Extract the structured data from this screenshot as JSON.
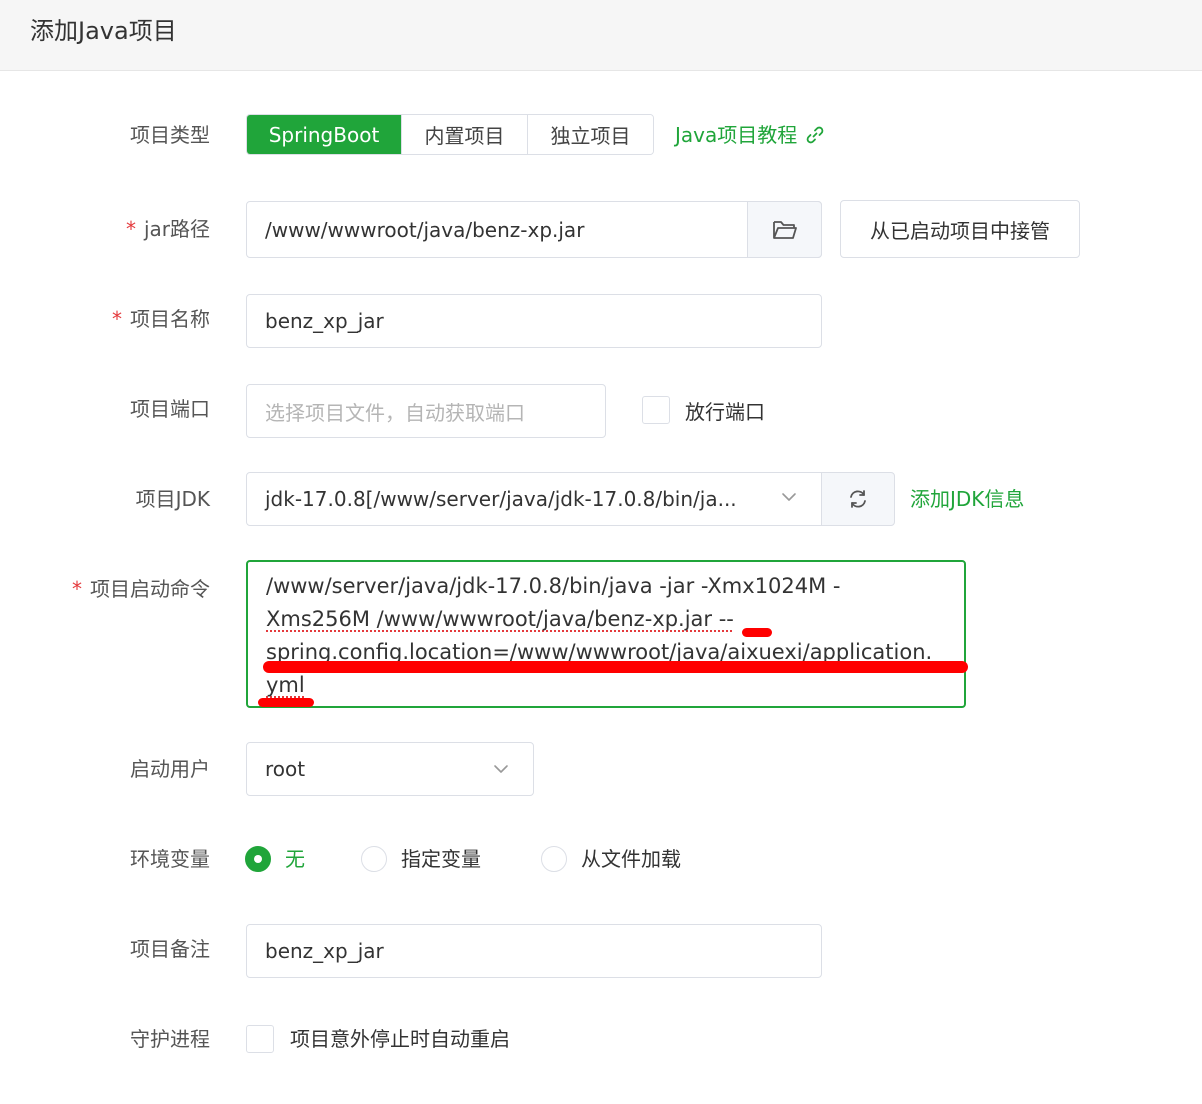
{
  "header": {
    "title": "添加Java项目"
  },
  "form": {
    "project_type": {
      "label": "项目类型",
      "options": [
        "SpringBoot",
        "内置项目",
        "独立项目"
      ],
      "selected": "SpringBoot",
      "tutorial_link": "Java项目教程"
    },
    "jar_path": {
      "required_mark": "*",
      "label": "jar路径",
      "value": "/www/wwwroot/java/benz-xp.jar",
      "takeover_button": "从已启动项目中接管"
    },
    "project_name": {
      "required_mark": "*",
      "label": "项目名称",
      "value": "benz_xp_jar"
    },
    "project_port": {
      "label": "项目端口",
      "placeholder": "选择项目文件，自动获取端口",
      "release_port_label": "放行端口"
    },
    "project_jdk": {
      "label": "项目JDK",
      "value": "jdk-17.0.8[/www/server/java/jdk-17.0.8/bin/ja...",
      "add_jdk_link": "添加JDK信息"
    },
    "start_command": {
      "required_mark": "*",
      "label": "项目启动命令",
      "lines": [
        "/www/server/java/jdk-17.0.8/bin/java -jar -Xmx1024M -",
        "Xms256M  /www/wwwroot/java/benz-xp.jar --",
        "spring.config.location=/www/wwwroot/java/aixuexi/application.",
        "yml"
      ]
    },
    "start_user": {
      "label": "启动用户",
      "value": "root"
    },
    "env_vars": {
      "label": "环境变量",
      "options": [
        "无",
        "指定变量",
        "从文件加载"
      ],
      "selected": "无"
    },
    "project_note": {
      "label": "项目备注",
      "value": "benz_xp_jar"
    },
    "daemon": {
      "label": "守护进程",
      "checkbox_label": "项目意外停止时自动重启"
    }
  },
  "colors": {
    "accent": "#20a53a",
    "required": "#e4393c",
    "annotation": "#ff0000"
  }
}
